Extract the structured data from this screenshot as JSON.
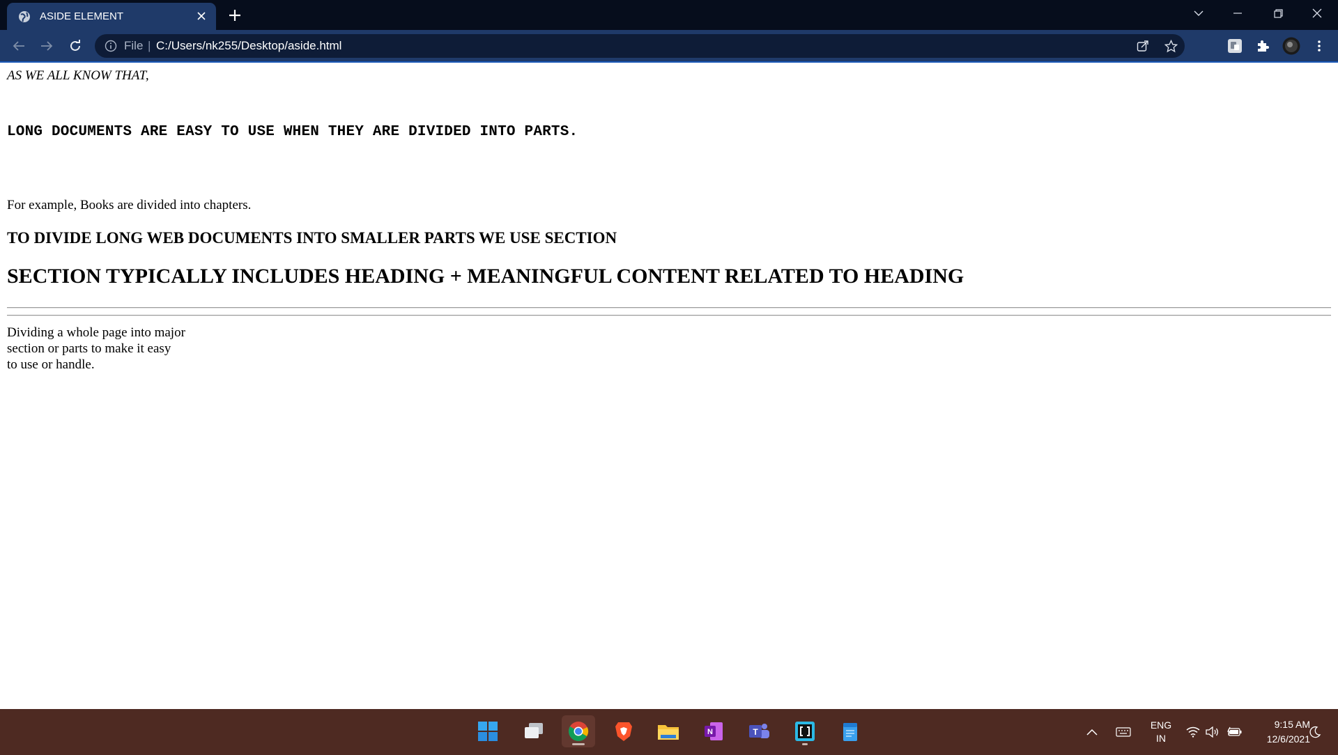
{
  "browser": {
    "tab_title": "ASIDE ELEMENT",
    "address_scheme": "File",
    "address_url": "C:/Users/nk255/Desktop/aside.html"
  },
  "page": {
    "intro": "AS WE ALL KNOW THAT,",
    "mono_heading": "LONG DOCUMENTS ARE EASY TO USE WHEN THEY ARE DIVIDED INTO PARTS.",
    "paragraph": "For example, Books are divided into chapters.",
    "h3": "TO DIVIDE LONG WEB DOCUMENTS INTO SMALLER PARTS WE USE SECTION",
    "h2": "SECTION TYPICALLY INCLUDES HEADING + MEANINGFUL CONTENT RELATED TO HEADING",
    "aside_lines": [
      "Dividing a whole page into major",
      "section or parts to make it easy",
      "to use or handle."
    ]
  },
  "taskbar": {
    "lang_line1": "ENG",
    "lang_line2": "IN",
    "time": "9:15 AM",
    "date": "12/6/2021"
  },
  "colors": {
    "tab_strip": "#060d1c",
    "toolbar": "#1f3a69",
    "omnibox": "#0e1c37",
    "taskbar": "#4e2a22"
  }
}
